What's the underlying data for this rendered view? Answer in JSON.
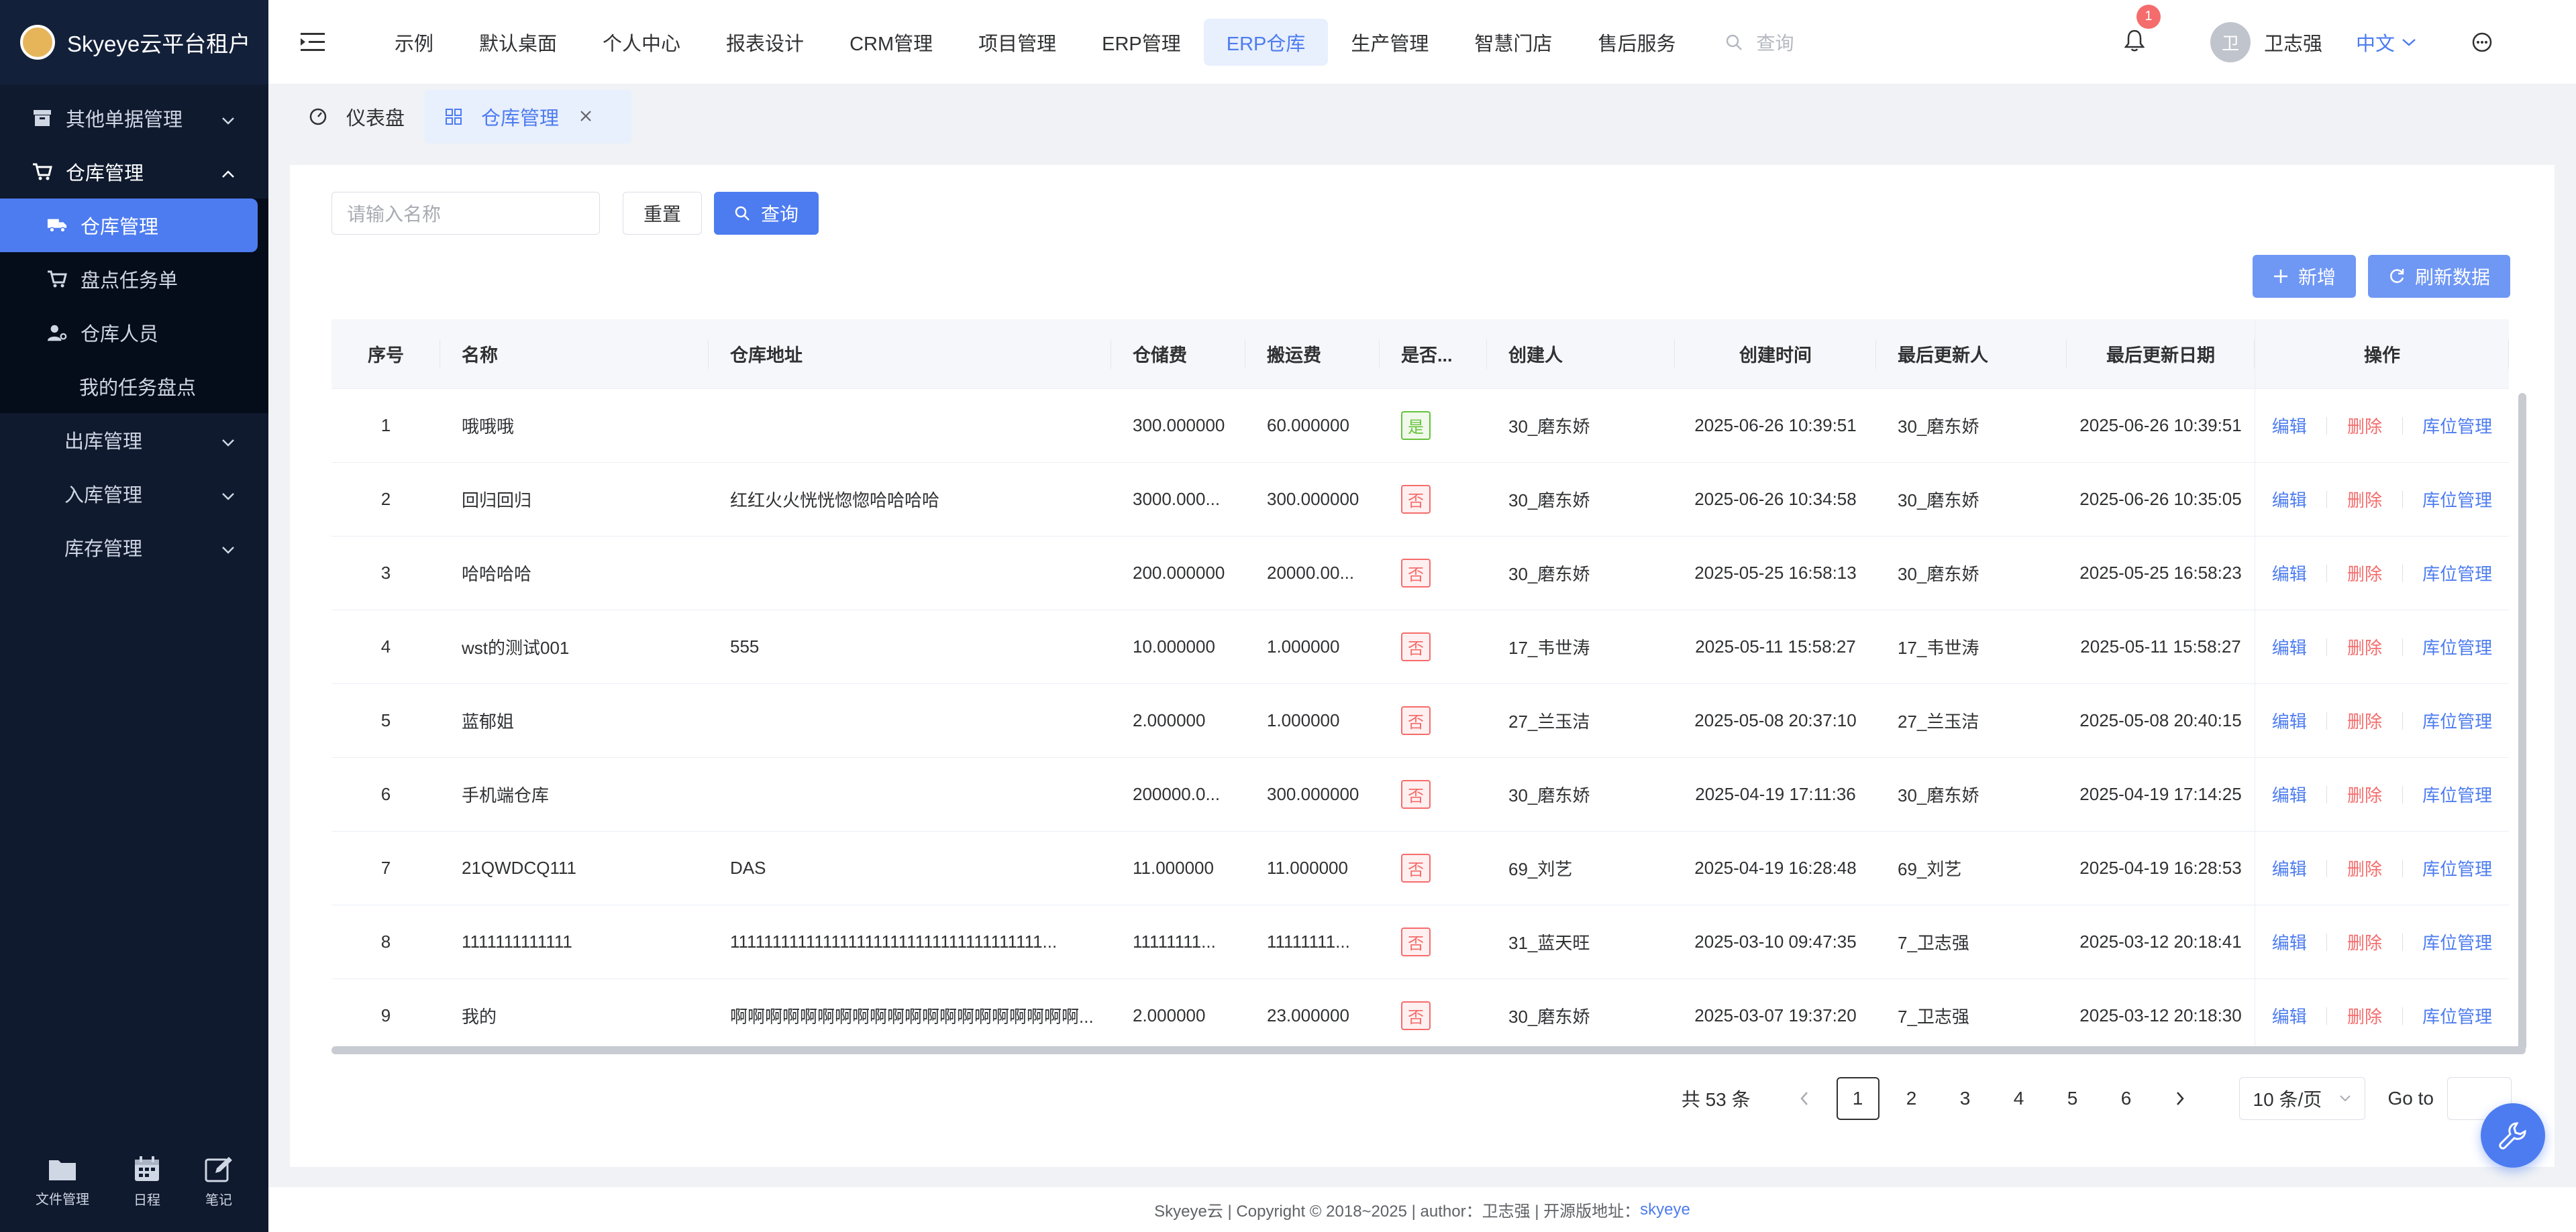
{
  "brand": {
    "title": "Skyeye云平台租户"
  },
  "sidebar": {
    "items": [
      {
        "label": "其他单据管理",
        "level": 0
      },
      {
        "label": "仓库管理",
        "level": 0
      },
      {
        "label": "仓库管理",
        "level": 1
      },
      {
        "label": "盘点任务单",
        "level": 1
      },
      {
        "label": "仓库人员",
        "level": 1
      },
      {
        "label": "我的任务盘点",
        "level": 2
      },
      {
        "label": "出库管理",
        "level": 0
      },
      {
        "label": "入库管理",
        "level": 0
      },
      {
        "label": "库存管理",
        "level": 0
      }
    ],
    "bottom": [
      {
        "label": "文件管理",
        "icon": "folder-icon"
      },
      {
        "label": "日程",
        "icon": "calendar-icon"
      },
      {
        "label": "笔记",
        "icon": "note-edit-icon"
      }
    ]
  },
  "header": {
    "nav": [
      "示例",
      "默认桌面",
      "个人中心",
      "报表设计",
      "CRM管理",
      "项目管理",
      "ERP管理",
      "ERP仓库",
      "生产管理",
      "智慧门店",
      "售后服务"
    ],
    "active_nav": "ERP仓库",
    "search_placeholder": "查询",
    "notifications": "1",
    "avatar_text": "卫",
    "user_name": "卫志强",
    "language": "中文"
  },
  "page_tabs": [
    {
      "label": "仪表盘",
      "icon": "dashboard-icon"
    },
    {
      "label": "仓库管理",
      "icon": "grid-icon"
    }
  ],
  "search": {
    "placeholder": "请输入名称",
    "reset_label": "重置",
    "query_label": "查询"
  },
  "actions": {
    "add_label": "新增",
    "refresh_label": "刷新数据"
  },
  "table": {
    "headers": [
      "序号",
      "名称",
      "仓库地址",
      "仓储费",
      "搬运费",
      "是否...",
      "创建人",
      "创建时间",
      "最后更新人",
      "最后更新日期",
      "操作"
    ],
    "ops": {
      "edit": "编辑",
      "delete": "删除",
      "location": "库位管理"
    },
    "rows": [
      {
        "idx": "1",
        "name": "哦哦哦",
        "addr": "",
        "storage": "300.000000",
        "handling": "60.000000",
        "flag": "是",
        "creator": "30_磨东娇",
        "created": "2025-06-26 10:39:51",
        "updater": "30_磨东娇",
        "updated": "2025-06-26 10:39:51"
      },
      {
        "idx": "2",
        "name": "回归回归",
        "addr": "红红火火恍恍惚惚哈哈哈哈",
        "storage": "3000.000...",
        "handling": "300.000000",
        "flag": "否",
        "creator": "30_磨东娇",
        "created": "2025-06-26 10:34:58",
        "updater": "30_磨东娇",
        "updated": "2025-06-26 10:35:05"
      },
      {
        "idx": "3",
        "name": "哈哈哈哈",
        "addr": "",
        "storage": "200.000000",
        "handling": "20000.00...",
        "flag": "否",
        "creator": "30_磨东娇",
        "created": "2025-05-25 16:58:13",
        "updater": "30_磨东娇",
        "updated": "2025-05-25 16:58:23"
      },
      {
        "idx": "4",
        "name": "wst的测试001",
        "addr": "555",
        "storage": "10.000000",
        "handling": "1.000000",
        "flag": "否",
        "creator": "17_韦世涛",
        "created": "2025-05-11 15:58:27",
        "updater": "17_韦世涛",
        "updated": "2025-05-11 15:58:27"
      },
      {
        "idx": "5",
        "name": "蓝郁姐",
        "addr": "",
        "storage": "2.000000",
        "handling": "1.000000",
        "flag": "否",
        "creator": "27_兰玉洁",
        "created": "2025-05-08 20:37:10",
        "updater": "27_兰玉洁",
        "updated": "2025-05-08 20:40:15"
      },
      {
        "idx": "6",
        "name": "手机端仓库",
        "addr": "",
        "storage": "200000.0...",
        "handling": "300.000000",
        "flag": "否",
        "creator": "30_磨东娇",
        "created": "2025-04-19 17:11:36",
        "updater": "30_磨东娇",
        "updated": "2025-04-19 17:14:25"
      },
      {
        "idx": "7",
        "name": "21QWDCQ111",
        "addr": "DAS",
        "storage": "11.000000",
        "handling": "11.000000",
        "flag": "否",
        "creator": "69_刘艺",
        "created": "2025-04-19 16:28:48",
        "updater": "69_刘艺",
        "updated": "2025-04-19 16:28:53"
      },
      {
        "idx": "8",
        "name": "1111111111111",
        "addr": "1111111111111111111111111111111111111...",
        "storage": "11111111...",
        "handling": "11111111...",
        "flag": "否",
        "creator": "31_蓝天旺",
        "created": "2025-03-10 09:47:35",
        "updater": "7_卫志强",
        "updated": "2025-03-12 20:18:41"
      },
      {
        "idx": "9",
        "name": "我的",
        "addr": "啊啊啊啊啊啊啊啊啊啊啊啊啊啊啊啊啊啊啊啊...",
        "storage": "2.000000",
        "handling": "23.000000",
        "flag": "否",
        "creator": "30_磨东娇",
        "created": "2025-03-07 19:37:20",
        "updater": "7_卫志强",
        "updated": "2025-03-12 20:18:30"
      }
    ]
  },
  "pagination": {
    "total": "共 53 条",
    "pages": [
      "1",
      "2",
      "3",
      "4",
      "5",
      "6"
    ],
    "current": "1",
    "page_size": "10 条/页",
    "goto_label": "Go to"
  },
  "footer": {
    "text": "Skyeye云 | Copyright © 2018~2025 | author：卫志强 | 开源版地址：",
    "link": "skyeye"
  },
  "colors": {
    "primary": "#4d7cf0",
    "sidebar": "#0f1a2e",
    "danger": "#f56c6c",
    "success": "#67c23a"
  }
}
